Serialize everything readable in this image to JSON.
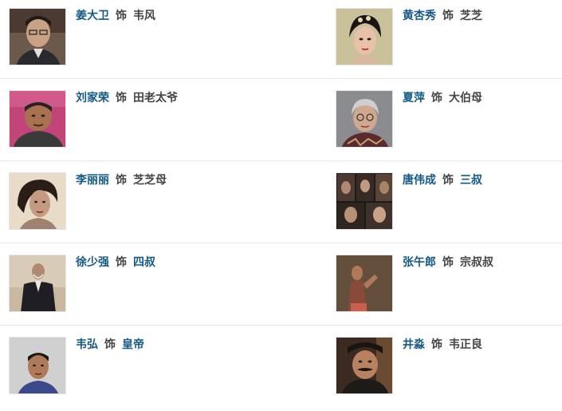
{
  "cast": [
    {
      "actor": "姜大卫",
      "verb": "饰",
      "role": "韦风",
      "role_linked": false,
      "photo": "portrait-photo"
    },
    {
      "actor": "黄杏秀",
      "verb": "饰",
      "role": "芝芝",
      "role_linked": false,
      "photo": "portrait-photo"
    },
    {
      "actor": "刘家荣",
      "verb": "饰",
      "role": "田老太爷",
      "role_linked": false,
      "photo": "portrait-photo"
    },
    {
      "actor": "夏萍",
      "verb": "饰",
      "role": "大伯母",
      "role_linked": false,
      "photo": "portrait-photo"
    },
    {
      "actor": "李丽丽",
      "verb": "饰",
      "role": "芝芝母",
      "role_linked": false,
      "photo": "portrait-photo"
    },
    {
      "actor": "唐伟成",
      "verb": "饰",
      "role": "三叔",
      "role_linked": true,
      "photo": "film-stills-collage"
    },
    {
      "actor": "徐少强",
      "verb": "饰",
      "role": "四叔",
      "role_linked": true,
      "photo": "portrait-photo"
    },
    {
      "actor": "张午郎",
      "verb": "饰",
      "role": "宗叔叔",
      "role_linked": false,
      "photo": "film-still"
    },
    {
      "actor": "韦弘",
      "verb": "饰",
      "role": "皇帝",
      "role_linked": true,
      "photo": "portrait-photo"
    },
    {
      "actor": "井淼",
      "verb": "饰",
      "role": "韦正良",
      "role_linked": false,
      "photo": "film-still"
    }
  ],
  "colors": {
    "link": "#135984",
    "text": "#444444",
    "divider": "#e6e6e6",
    "background": "#ffffff"
  }
}
